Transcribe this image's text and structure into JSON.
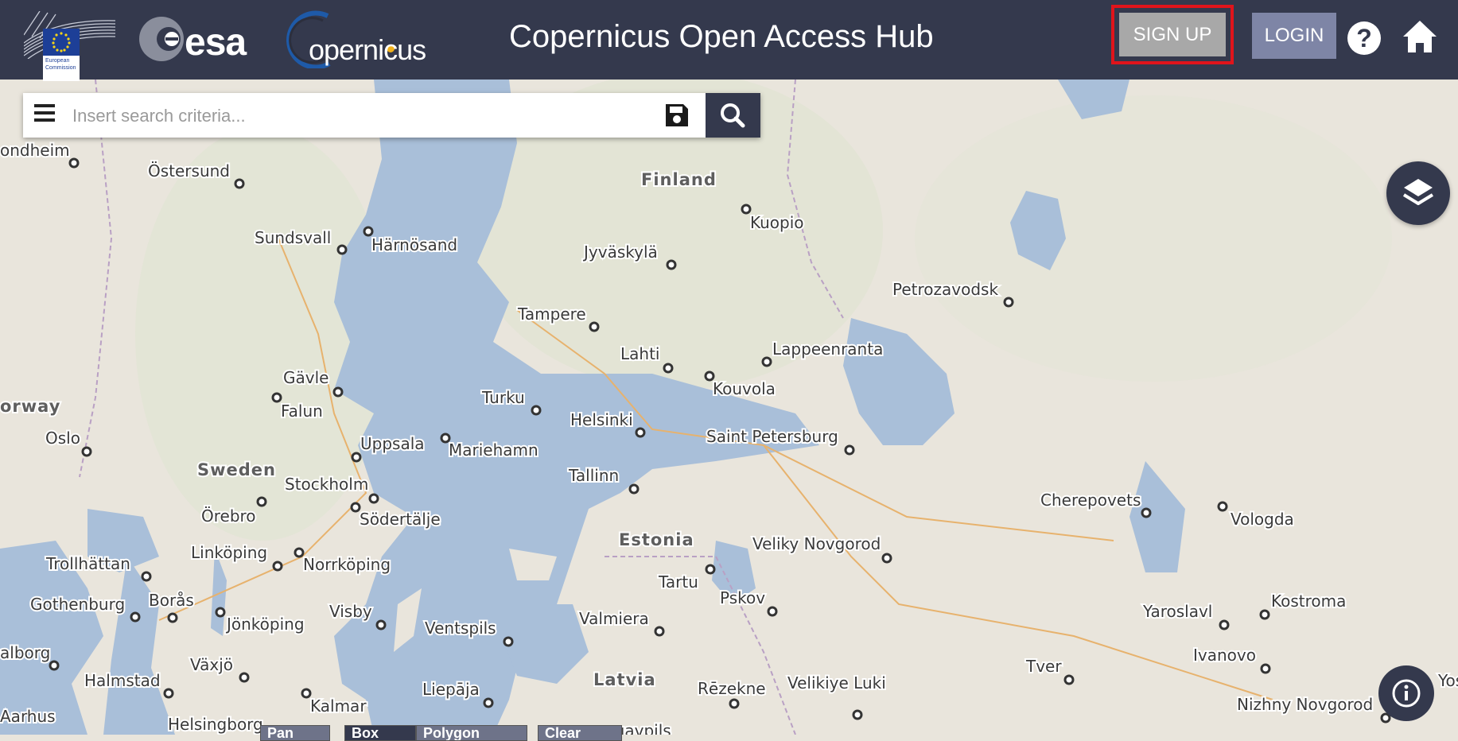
{
  "header": {
    "title": "Copernicus Open Access Hub",
    "ec_logo_text": "European Commission",
    "esa_logo_text": "esa",
    "copernicus_logo_text": "opernicus",
    "signup_label": "SIGN UP",
    "login_label": "LOGIN",
    "help_icon": "help-circle-icon",
    "home_icon": "home-icon"
  },
  "search": {
    "placeholder": "Insert search criteria...",
    "value": ""
  },
  "map": {
    "countries": [
      "Finland",
      "Sweden",
      "Estonia",
      "Latvia",
      "orway"
    ],
    "cities": [
      "ondheim",
      "Östersund",
      "Sundsvall",
      "Härnösand",
      "Kuopio",
      "Jyväskylä",
      "Petrozavodsk",
      "Tampere",
      "Lahti",
      "Lappeenranta",
      "Kouvola",
      "Gävle",
      "Falun",
      "Turku",
      "Helsinki",
      "Oslo",
      "Uppsala",
      "Mariehamn",
      "Saint Petersburg",
      "Stockholm",
      "Tallinn",
      "Örebro",
      "Södertälje",
      "Cherepovets",
      "Vologda",
      "Linköping",
      "Norrköping",
      "Trollhättan",
      "Veliky Novgorod",
      "Gothenburg",
      "Borås",
      "Jönköping",
      "Visby",
      "Tartu",
      "Pskov",
      "Ventspils",
      "Valmiera",
      "Yaroslavl",
      "Kostroma",
      "alborg",
      "Växjö",
      "Halmstad",
      "Kalmar",
      "Liepāja",
      "Rēzekne",
      "Velikiye Luki",
      "Tver",
      "Ivanovo",
      "Nizhny Novgorod",
      "Aarhus",
      "Helsingborg",
      "ugavpils",
      "Yos"
    ]
  },
  "controls": {
    "layers_icon": "layers-icon",
    "info_icon": "info-icon",
    "bottom_buttons": [
      "Pan",
      "Box",
      "Polygon",
      "Clear"
    ]
  },
  "colors": {
    "header_bg": "#34394d",
    "signup_bg": "#a8a8a8",
    "login_bg": "#7e85a6",
    "highlight": "#e0141b",
    "water": "#a9bfd9",
    "land": "#e9e5dc"
  }
}
